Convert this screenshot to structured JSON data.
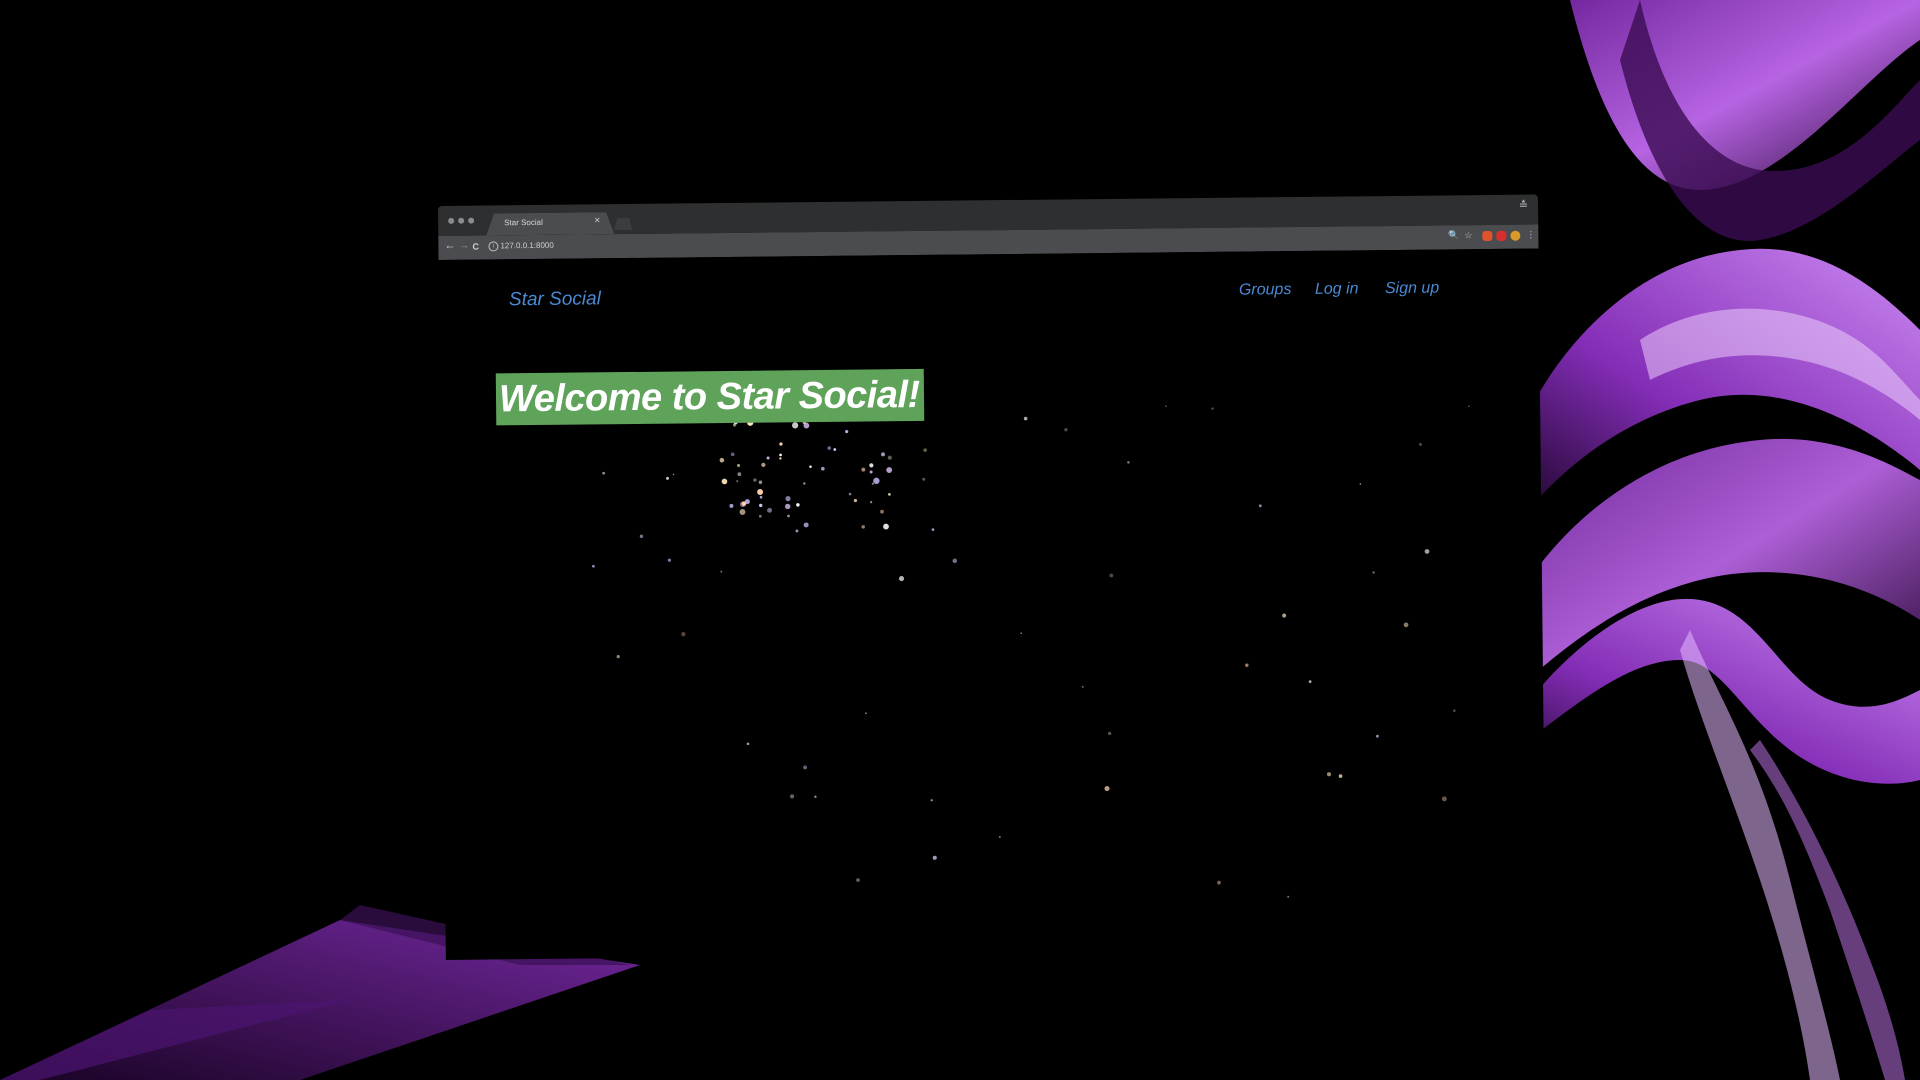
{
  "browser": {
    "tab_title": "Star Social",
    "tab_close": "×",
    "url": "127.0.0.1:8000",
    "back": "←",
    "forward": "→",
    "reload": "C",
    "profile": "≛",
    "extensions": {
      "zoom": "🔍",
      "star": "☆",
      "menu": "⋮"
    }
  },
  "site": {
    "brand": "Star Social",
    "nav": {
      "groups": "Groups",
      "login": "Log in",
      "signup": "Sign up"
    },
    "welcome": "Welcome to Star Social!"
  },
  "colors": {
    "link": "#4a8ad4",
    "welcome_bg": "#5fa35b",
    "wave_purple": "#a64ad8"
  },
  "icons": {
    "info": "i"
  }
}
